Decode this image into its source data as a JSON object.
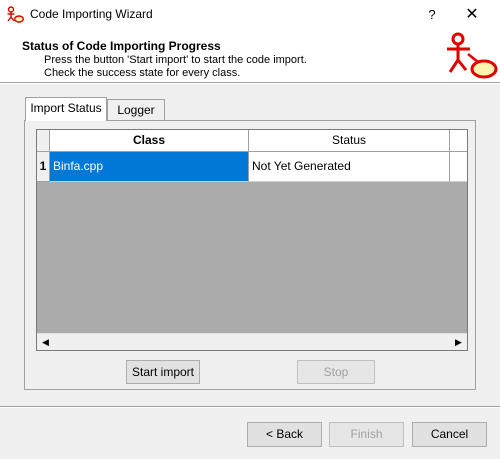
{
  "window": {
    "title": "Code Importing Wizard",
    "help_label": "?",
    "close_label": "✕",
    "icon": "uml-actor-icon"
  },
  "header": {
    "title": "Status of Code Importing Progress",
    "line1": "Press the button 'Start import' to start the code import.",
    "line2": "Check the success state for every class.",
    "logo_icon": "uml-actor-usecase-icon",
    "logo_color": "#e00000"
  },
  "tabs": [
    {
      "label": "Import Status",
      "active": true
    },
    {
      "label": "Logger",
      "active": false
    }
  ],
  "grid": {
    "columns": [
      "Class",
      "Status"
    ],
    "rows": [
      {
        "index": "1",
        "class": "Binfa.cpp",
        "status": "Not Yet Generated"
      }
    ],
    "selection_color": "#0078d7"
  },
  "buttons": {
    "start_import": "Start import",
    "stop": "Stop",
    "back": "< Back",
    "finish": "Finish",
    "cancel": "Cancel"
  }
}
